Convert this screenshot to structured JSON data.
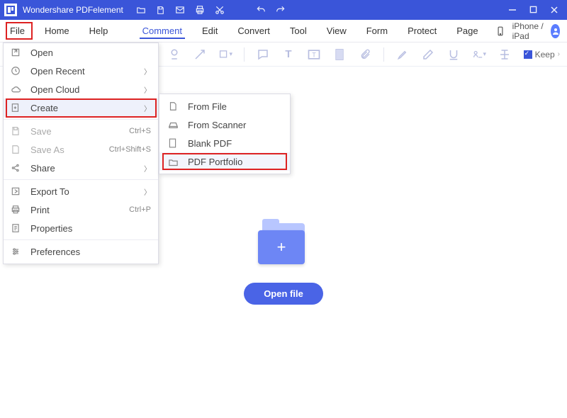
{
  "titlebar": {
    "app_title": "Wondershare PDFelement"
  },
  "menubar": {
    "items": [
      "File",
      "Home",
      "Help",
      "Comment",
      "Edit",
      "Convert",
      "Tool",
      "View",
      "Form",
      "Protect",
      "Page"
    ],
    "active_index": 3,
    "device_label": "iPhone / iPad"
  },
  "toolbar": {
    "keep_label": "Keep"
  },
  "file_menu": {
    "items": [
      {
        "icon": "open-icon",
        "label": "Open",
        "accel": "",
        "arrow": false
      },
      {
        "icon": "recent-icon",
        "label": "Open Recent",
        "accel": "",
        "arrow": true
      },
      {
        "icon": "cloud-icon",
        "label": "Open Cloud",
        "accel": "",
        "arrow": true
      },
      {
        "icon": "create-icon",
        "label": "Create",
        "accel": "",
        "arrow": true
      },
      {
        "icon": "save-icon",
        "label": "Save",
        "accel": "Ctrl+S",
        "arrow": false
      },
      {
        "icon": "saveas-icon",
        "label": "Save As",
        "accel": "Ctrl+Shift+S",
        "arrow": false
      },
      {
        "icon": "share-icon",
        "label": "Share",
        "accel": "",
        "arrow": true
      },
      {
        "icon": "export-icon",
        "label": "Export To",
        "accel": "",
        "arrow": true
      },
      {
        "icon": "print-icon",
        "label": "Print",
        "accel": "Ctrl+P",
        "arrow": false
      },
      {
        "icon": "properties-icon",
        "label": "Properties",
        "accel": "",
        "arrow": false
      },
      {
        "icon": "preferences-icon",
        "label": "Preferences",
        "accel": "",
        "arrow": false
      }
    ]
  },
  "create_menu": {
    "items": [
      {
        "icon": "file-icon",
        "label": "From File"
      },
      {
        "icon": "scanner-icon",
        "label": "From Scanner"
      },
      {
        "icon": "blank-icon",
        "label": "Blank PDF"
      },
      {
        "icon": "portfolio-icon",
        "label": "PDF Portfolio"
      }
    ]
  },
  "main": {
    "open_file_button": "Open file"
  }
}
